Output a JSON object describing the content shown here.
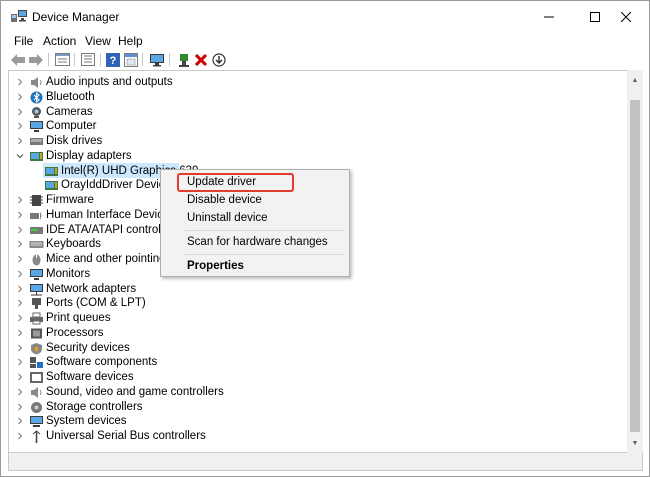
{
  "window": {
    "title": "Device Manager",
    "minimize_glyph": "—",
    "maximize_glyph": "☐",
    "close_glyph": "✕"
  },
  "menubar": {
    "items": [
      {
        "label": "File"
      },
      {
        "label": "Action"
      },
      {
        "label": "View"
      },
      {
        "label": "Help"
      }
    ]
  },
  "toolbar": {
    "buttons": [
      {
        "icon": "back-arrow-icon",
        "glyph": "⇦"
      },
      {
        "icon": "forward-arrow-icon",
        "glyph": "⇨"
      },
      {
        "icon": "properties-icon"
      },
      {
        "icon": "show-hide-console-tree-icon"
      },
      {
        "icon": "help-icon",
        "glyph": "?"
      },
      {
        "icon": "scan-hardware-icon"
      },
      {
        "icon": "update-driver-icon"
      },
      {
        "icon": "uninstall-device-icon",
        "glyph": "✖"
      },
      {
        "icon": "download-driver-icon",
        "glyph": "⬇"
      }
    ]
  },
  "tree": {
    "items": [
      {
        "label": "Audio inputs and outputs",
        "icon": "speaker-icon",
        "expanded": false
      },
      {
        "label": "Bluetooth",
        "icon": "bluetooth-icon",
        "expanded": false
      },
      {
        "label": "Cameras",
        "icon": "camera-icon",
        "expanded": false
      },
      {
        "label": "Computer",
        "icon": "computer-icon",
        "expanded": false
      },
      {
        "label": "Disk drives",
        "icon": "disk-drive-icon",
        "expanded": false
      },
      {
        "label": "Display adapters",
        "icon": "display-adapter-icon",
        "expanded": true
      },
      {
        "label": "Intel(R) UHD Graphics 630",
        "icon": "display-adapter-icon",
        "child": true,
        "selected": true
      },
      {
        "label": "OrayIddDriver Device",
        "icon": "display-adapter-icon",
        "child": true
      },
      {
        "label": "Firmware",
        "icon": "firmware-icon",
        "expanded": false
      },
      {
        "label": "Human Interface Devices",
        "icon": "hid-icon",
        "expanded": false
      },
      {
        "label": "IDE ATA/ATAPI controllers",
        "icon": "ide-controller-icon",
        "expanded": false
      },
      {
        "label": "Keyboards",
        "icon": "keyboard-icon",
        "expanded": false
      },
      {
        "label": "Mice and other pointing devices",
        "icon": "mouse-icon",
        "expanded": false
      },
      {
        "label": "Monitors",
        "icon": "monitor-icon",
        "expanded": false
      },
      {
        "label": "Network adapters",
        "icon": "network-adapter-icon",
        "expanded": false
      },
      {
        "label": "Ports (COM & LPT)",
        "icon": "port-icon",
        "expanded": false
      },
      {
        "label": "Print queues",
        "icon": "printer-icon",
        "expanded": false
      },
      {
        "label": "Processors",
        "icon": "processor-icon",
        "expanded": false
      },
      {
        "label": "Security devices",
        "icon": "security-icon",
        "expanded": false
      },
      {
        "label": "Software components",
        "icon": "software-component-icon",
        "expanded": false
      },
      {
        "label": "Software devices",
        "icon": "software-device-icon",
        "expanded": false
      },
      {
        "label": "Sound, video and game controllers",
        "icon": "sound-icon",
        "expanded": false
      },
      {
        "label": "Storage controllers",
        "icon": "storage-controller-icon",
        "expanded": false
      },
      {
        "label": "System devices",
        "icon": "system-device-icon",
        "expanded": false
      },
      {
        "label": "Universal Serial Bus controllers",
        "icon": "usb-icon",
        "expanded": false
      }
    ]
  },
  "context_menu": {
    "items": [
      {
        "label": "Update driver",
        "highlighted": true
      },
      {
        "label": "Disable device"
      },
      {
        "label": "Uninstall device"
      },
      {
        "label": "Scan for hardware changes"
      },
      {
        "label": "Properties",
        "bold": true
      }
    ],
    "highlight_color": "#e43b2f"
  },
  "colors": {
    "selection": "#cce8ff",
    "accent_blue": "#1e73be",
    "toolbar_red": "#d00000",
    "toolbar_green": "#2c8a2c"
  }
}
